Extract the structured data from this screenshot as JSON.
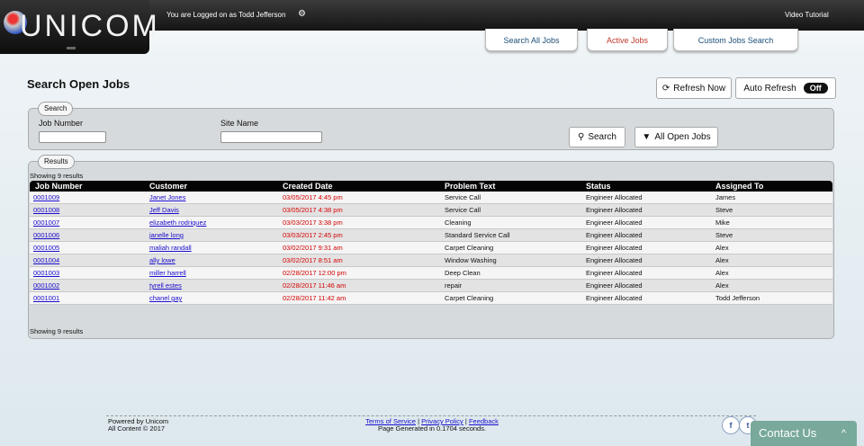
{
  "header": {
    "logo_text": "UNICOM",
    "login_text": "You are Logged on as Todd Jefferson",
    "video_link": "Video Tutorial",
    "tabs": [
      {
        "label": "Search All Jobs"
      },
      {
        "label": "Active Jobs"
      },
      {
        "label": "Custom Jobs Search"
      }
    ]
  },
  "page": {
    "title": "Search Open Jobs",
    "refresh_label": "Refresh Now",
    "auto_refresh_label": "Auto Refresh",
    "auto_refresh_state": "Off"
  },
  "search": {
    "legend": "Search",
    "job_number_label": "Job Number",
    "job_number_value": "",
    "site_name_label": "Site Name",
    "site_name_value": "",
    "search_button": "Search",
    "all_open_button": "All Open Jobs"
  },
  "results": {
    "legend": "Results",
    "showing_top": "Showing 9 results",
    "showing_bottom": "Showing 9 results",
    "columns": [
      "Job Number",
      "Customer",
      "Created Date",
      "Problem Text",
      "Status",
      "Assigned To"
    ],
    "rows": [
      [
        "0001009",
        "Janet Jones",
        "03/05/2017 4:45 pm",
        "Service Call",
        "Engineer Allocated",
        "James"
      ],
      [
        "0001008",
        "Jeff Davis",
        "03/05/2017 4:38 pm",
        "Service Call",
        "Engineer Allocated",
        "Steve"
      ],
      [
        "0001007",
        "elizabeth rodriquez",
        "03/03/2017 3:38 pm",
        "Cleaning",
        "Engineer Allocated",
        "Mike"
      ],
      [
        "0001006",
        "janelle long",
        "03/03/2017 2:45 pm",
        "Standard Service Call",
        "Engineer Allocated",
        "Steve"
      ],
      [
        "0001005",
        "maliah randall",
        "03/02/2017 9:31 am",
        "Carpet Cleaning",
        "Engineer Allocated",
        "Alex"
      ],
      [
        "0001004",
        "ally lowe",
        "03/02/2017 8:51 am",
        "Window Washing",
        "Engineer Allocated",
        "Alex"
      ],
      [
        "0001003",
        "miller harrell",
        "02/28/2017 12:00 pm",
        "Deep Clean",
        "Engineer Allocated",
        "Alex"
      ],
      [
        "0001002",
        "tyrell estes",
        "02/28/2017 11:46 am",
        "repair",
        "Engineer Allocated",
        "Alex"
      ],
      [
        "0001001",
        "chanel gay",
        "02/28/2017 11:42 am",
        "Carpet Cleaning",
        "Engineer Allocated",
        "Todd Jefferson"
      ]
    ]
  },
  "footer": {
    "powered_by": "Powered by Unicom",
    "copyright": "All Content © 2017",
    "terms": "Terms of Service",
    "privacy": "Privacy Policy",
    "feedback": "Feedback",
    "separator": "|",
    "generated": "Page Generated in 0.1704 seconds.",
    "social": [
      {
        "icon": "facebook-icon",
        "glyph": "f"
      },
      {
        "icon": "twitter-icon",
        "glyph": "t"
      }
    ]
  },
  "contact": {
    "label": "Contact Us",
    "icon": "chevron-up-icon"
  },
  "colors": {
    "date_text": "#d40000",
    "link": "#1a0dcc",
    "active_tab": "#c0392b",
    "contact_bg": "#78a99a"
  }
}
